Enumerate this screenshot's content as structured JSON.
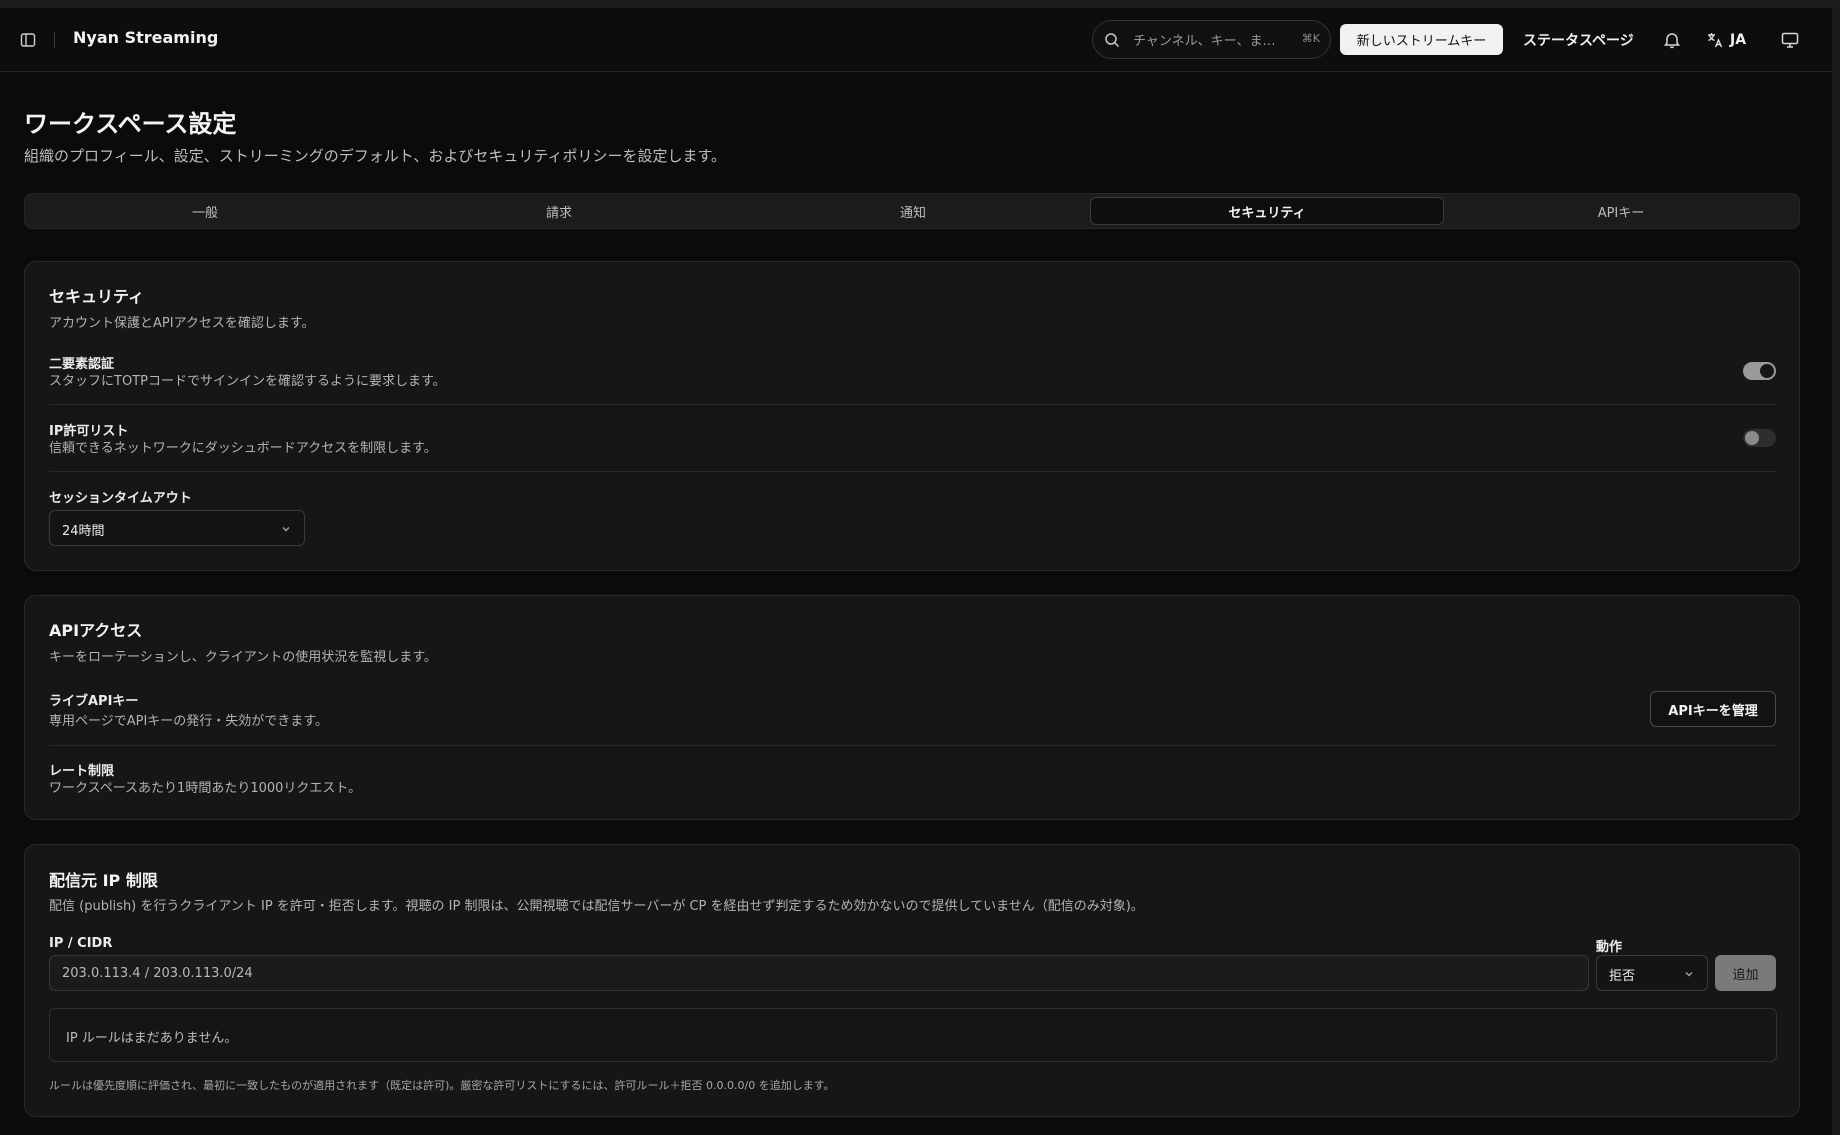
{
  "app": {
    "title": "Nyan Streaming"
  },
  "header": {
    "search_placeholder": "チャンネル、キー、ま…",
    "search_shortcut": "⌘K",
    "new_stream_key": "新しいストリームキー",
    "status_page": "ステータスページ",
    "language": "JA"
  },
  "page": {
    "title": "ワークスペース設定",
    "subtitle": "組織のプロフィール、設定、ストリーミングのデフォルト、およびセキュリティポリシーを設定します。"
  },
  "tabs": [
    {
      "label": "一般",
      "active": false
    },
    {
      "label": "請求",
      "active": false
    },
    {
      "label": "通知",
      "active": false
    },
    {
      "label": "セキュリティ",
      "active": true
    },
    {
      "label": "APIキー",
      "active": false
    }
  ],
  "security": {
    "title": "セキュリティ",
    "description": "アカウント保護とAPIアクセスを確認します。",
    "two_factor": {
      "label": "二要素認証",
      "description": "スタッフにTOTPコードでサインインを確認するように要求します。",
      "enabled": true
    },
    "ip_allowlist": {
      "label": "IP許可リスト",
      "description": "信頼できるネットワークにダッシュボードアクセスを制限します。",
      "enabled": false
    },
    "session_timeout": {
      "label": "セッションタイムアウト",
      "value": "24時間"
    }
  },
  "api_access": {
    "title": "APIアクセス",
    "description": "キーをローテーションし、クライアントの使用状況を監視します。",
    "live_key": {
      "label": "ライブAPIキー",
      "description": "専用ページでAPIキーの発行・失効ができます。",
      "button": "APIキーを管理"
    },
    "rate_limit": {
      "label": "レート制限",
      "description": "ワークスペースあたり1時間あたり1000リクエスト。"
    }
  },
  "publish_ip": {
    "title": "配信元 IP 制限",
    "description": "配信 (publish) を行うクライアント IP を許可・拒否します。視聴の IP 制限は、公開視聴では配信サーバーが CP を経由せず判定するため効かないので提供していません（配信のみ対象)。",
    "ip_label": "IP / CIDR",
    "ip_placeholder": "203.0.113.4 / 203.0.113.0/24",
    "action_label": "動作",
    "action_value": "拒否",
    "add_button": "追加",
    "empty_text": "IP ルールはまだありません。",
    "footnote": "ルールは優先度順に評価され、最初に一致したものが適用されます（既定は許可)。厳密な許可リストにするには、許可ルール＋拒否 0.0.0.0/0 を追加します。"
  }
}
